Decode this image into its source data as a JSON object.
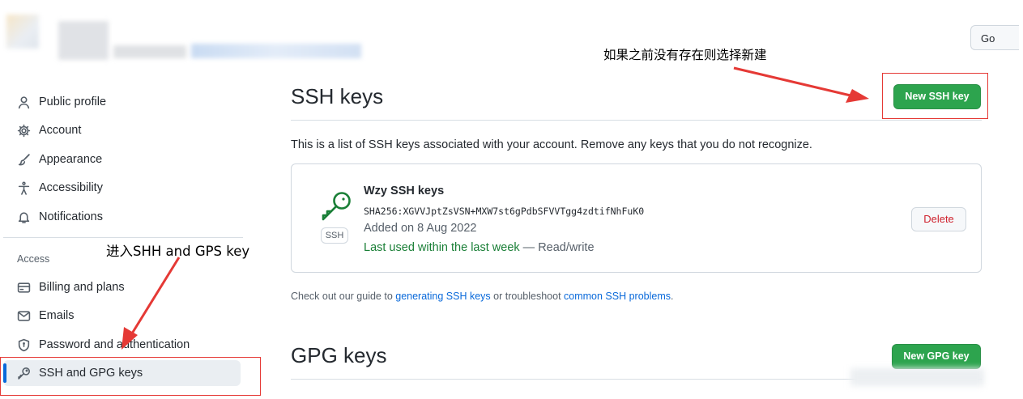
{
  "header": {
    "go_button": "Go"
  },
  "sidebar": {
    "items": [
      {
        "label": "Public profile",
        "icon": "person-icon"
      },
      {
        "label": "Account",
        "icon": "gear-icon"
      },
      {
        "label": "Appearance",
        "icon": "paintbrush-icon"
      },
      {
        "label": "Accessibility",
        "icon": "accessibility-icon"
      },
      {
        "label": "Notifications",
        "icon": "bell-icon"
      }
    ],
    "access_heading": "Access",
    "access_items": [
      {
        "label": "Billing and plans",
        "icon": "credit-card-icon"
      },
      {
        "label": "Emails",
        "icon": "mail-icon"
      },
      {
        "label": "Password and authentication",
        "icon": "shield-lock-icon"
      },
      {
        "label": "SSH and GPG keys",
        "icon": "key-icon",
        "active": true
      }
    ]
  },
  "main": {
    "ssh_heading": "SSH keys",
    "new_ssh_button": "New SSH key",
    "description": "This is a list of SSH keys associated with your account. Remove any keys that you do not recognize.",
    "key": {
      "title": "Wzy SSH keys",
      "fingerprint": "SHA256:XGVVJptZsVSN+MXW7st6gPdbSFVVTgg4zdtifNhFuK0",
      "type_label": "SSH",
      "added": "Added on 8 Aug 2022",
      "last_used": "Last used within the last week",
      "access": " — Read/write",
      "delete_button": "Delete"
    },
    "guide": {
      "prefix": "Check out our guide to ",
      "link1": "generating SSH keys",
      "middle": " or troubleshoot ",
      "link2": "common SSH problems",
      "suffix": "."
    },
    "gpg_heading": "GPG keys",
    "new_gpg_button": "New GPG key"
  },
  "annotations": {
    "note_new_key": "如果之前没有存在则选择新建",
    "note_enter": "进入SHH and GPS key"
  },
  "colors": {
    "primary_button": "#2da44e",
    "link": "#0969da",
    "active_indicator": "#0969da",
    "annotation": "#e53935",
    "danger": "#cf222e"
  }
}
